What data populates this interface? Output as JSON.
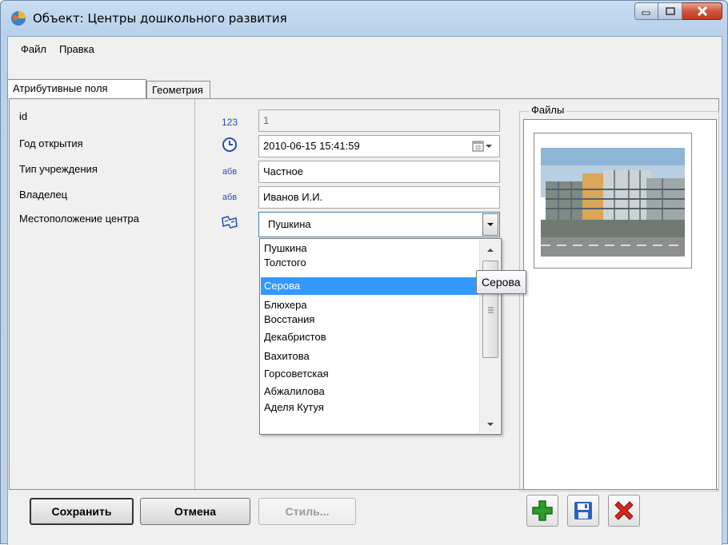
{
  "window": {
    "title": "Объект: Центры дошкольного развития"
  },
  "menu": {
    "items": [
      {
        "label": "Файл"
      },
      {
        "label": "Правка"
      }
    ]
  },
  "tabs": [
    {
      "label": "Атрибутивные поля",
      "active": true
    },
    {
      "label": "Геометрия",
      "active": false
    }
  ],
  "fields": [
    {
      "label": "id",
      "type_icon": "123",
      "value": "1",
      "readonly": true
    },
    {
      "label": "Год открытия",
      "type_icon": "clock-icon",
      "value": "2010-06-15 15:41:59"
    },
    {
      "label": "Тип учреждения",
      "type_icon": "абв",
      "value": "Частное"
    },
    {
      "label": "Владелец",
      "type_icon": "абв",
      "value": "Иванов И.И."
    },
    {
      "label": "Местоположение центра",
      "type_icon": "dictionary-icon",
      "value": "Пушкина"
    }
  ],
  "dropdown": {
    "options": [
      "Пушкина",
      "Толстого",
      "Серова",
      "Блюхера",
      "Восстания",
      "Декабристов",
      "Вахитова",
      "Горсоветская",
      "Абжалилова",
      "Аделя Кутуя"
    ],
    "highlighted": "Серова",
    "tooltip": "Серова"
  },
  "files": {
    "title": "Файлы"
  },
  "buttons": {
    "save": "Сохранить",
    "cancel": "Отмена",
    "style": "Стиль..."
  },
  "colors": {
    "selection": "#3399ff",
    "add_green": "#2e9b2a",
    "delete_red": "#d32a1e",
    "save_blue": "#2f5fbf"
  }
}
